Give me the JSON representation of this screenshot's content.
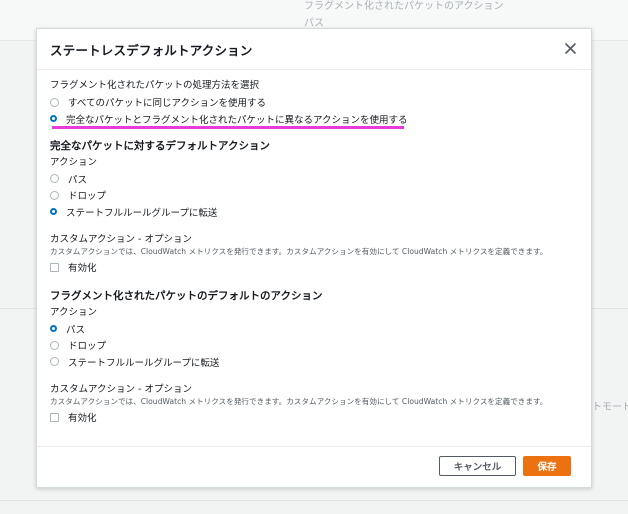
{
  "background": {
    "top_text_1": "フラグメント化されたパケットのアクション",
    "top_text_2": "パス",
    "right_text": "ストモードで"
  },
  "modal": {
    "title": "ステートレスデフォルトアクション",
    "fragment_prompt": "フラグメント化されたパケットの処理方法を選択",
    "fragment_options": [
      {
        "label": "すべてのパケットに同じアクションを使用する",
        "selected": false
      },
      {
        "label": "完全なパケットとフラグメント化されたパケットに異なるアクションを使用する",
        "selected": true
      }
    ],
    "full": {
      "title": "完全なパケットに対するデフォルトアクション",
      "action_label": "アクション",
      "options": [
        {
          "label": "パス",
          "selected": false
        },
        {
          "label": "ドロップ",
          "selected": false
        },
        {
          "label": "ステートフルルールグループに転送",
          "selected": true
        }
      ],
      "custom_title": "カスタムアクション - オプション",
      "custom_desc": "カスタムアクションでは、CloudWatch メトリクスを発行できます。カスタムアクションを有効にして CloudWatch メトリクスを定義できます。",
      "enable_label": "有効化"
    },
    "fragmented": {
      "title": "フラグメント化されたパケットのデフォルトのアクション",
      "action_label": "アクション",
      "options": [
        {
          "label": "パス",
          "selected": true
        },
        {
          "label": "ドロップ",
          "selected": false
        },
        {
          "label": "ステートフルルールグループに転送",
          "selected": false
        }
      ],
      "custom_title": "カスタムアクション - オプション",
      "custom_desc": "カスタムアクションでは、CloudWatch メトリクスを発行できます。カスタムアクションを有効にして CloudWatch メトリクスを定義できます。",
      "enable_label": "有効化"
    },
    "cancel_label": "キャンセル",
    "save_label": "保存"
  },
  "colors": {
    "primary": "#ec7211",
    "radio_selected": "#0073bb",
    "highlight": "#e83cd8"
  }
}
